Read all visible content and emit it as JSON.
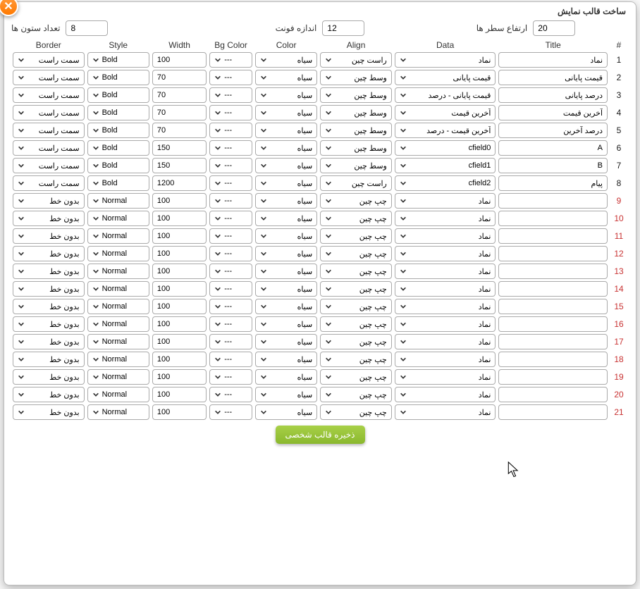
{
  "dialog_title": "ساخت قالب نمایش",
  "close_icon": "✕",
  "top": {
    "columns_label": "تعداد ستون ها",
    "columns_value": "8",
    "font_label": "اندازه فونت",
    "font_value": "12",
    "row_height_label": "ارتفاع سطر ها",
    "row_height_value": "20"
  },
  "headers": {
    "hash": "#",
    "title": "Title",
    "data": "Data",
    "align": "Align",
    "color": "Color",
    "bg": "Bg Color",
    "width": "Width",
    "style": "Style",
    "border": "Border"
  },
  "rows": [
    {
      "n": "1",
      "active": true,
      "title": "نماد",
      "data": "نماد",
      "align": "راست چین",
      "color": "سیاه",
      "bg": "---",
      "width": "100",
      "style": "Bold",
      "border": "سمت راست"
    },
    {
      "n": "2",
      "active": true,
      "title": "قیمت پایانی",
      "data": "قیمت پایانی",
      "align": "وسط چین",
      "color": "سیاه",
      "bg": "---",
      "width": "70",
      "style": "Bold",
      "border": "سمت راست"
    },
    {
      "n": "3",
      "active": true,
      "title": "درصد پایانی",
      "data": "قیمت پایانی - درصد",
      "align": "وسط چین",
      "color": "سیاه",
      "bg": "---",
      "width": "70",
      "style": "Bold",
      "border": "سمت راست"
    },
    {
      "n": "4",
      "active": true,
      "title": "آخرین قیمت",
      "data": "آخرین قیمت",
      "align": "وسط چین",
      "color": "سیاه",
      "bg": "---",
      "width": "70",
      "style": "Bold",
      "border": "سمت راست"
    },
    {
      "n": "5",
      "active": true,
      "title": "درصد آخرین",
      "data": "آخرین قیمت - درصد",
      "align": "وسط چین",
      "color": "سیاه",
      "bg": "---",
      "width": "70",
      "style": "Bold",
      "border": "سمت راست"
    },
    {
      "n": "6",
      "active": true,
      "title": "A",
      "data": "cfield0",
      "align": "وسط چین",
      "color": "سیاه",
      "bg": "---",
      "width": "150",
      "style": "Bold",
      "border": "سمت راست"
    },
    {
      "n": "7",
      "active": true,
      "title": "B",
      "data": "cfield1",
      "align": "وسط چین",
      "color": "سیاه",
      "bg": "---",
      "width": "150",
      "style": "Bold",
      "border": "سمت راست"
    },
    {
      "n": "8",
      "active": true,
      "title": "پیام",
      "data": "cfield2",
      "align": "راست چین",
      "color": "سیاه",
      "bg": "---",
      "width": "1200",
      "style": "Bold",
      "border": "سمت راست"
    },
    {
      "n": "9",
      "active": false,
      "title": "",
      "data": "نماد",
      "align": "چپ چین",
      "color": "سیاه",
      "bg": "---",
      "width": "100",
      "style": "Normal",
      "border": "بدون خط"
    },
    {
      "n": "10",
      "active": false,
      "title": "",
      "data": "نماد",
      "align": "چپ چین",
      "color": "سیاه",
      "bg": "---",
      "width": "100",
      "style": "Normal",
      "border": "بدون خط"
    },
    {
      "n": "11",
      "active": false,
      "title": "",
      "data": "نماد",
      "align": "چپ چین",
      "color": "سیاه",
      "bg": "---",
      "width": "100",
      "style": "Normal",
      "border": "بدون خط"
    },
    {
      "n": "12",
      "active": false,
      "title": "",
      "data": "نماد",
      "align": "چپ چین",
      "color": "سیاه",
      "bg": "---",
      "width": "100",
      "style": "Normal",
      "border": "بدون خط"
    },
    {
      "n": "13",
      "active": false,
      "title": "",
      "data": "نماد",
      "align": "چپ چین",
      "color": "سیاه",
      "bg": "---",
      "width": "100",
      "style": "Normal",
      "border": "بدون خط"
    },
    {
      "n": "14",
      "active": false,
      "title": "",
      "data": "نماد",
      "align": "چپ چین",
      "color": "سیاه",
      "bg": "---",
      "width": "100",
      "style": "Normal",
      "border": "بدون خط"
    },
    {
      "n": "15",
      "active": false,
      "title": "",
      "data": "نماد",
      "align": "چپ چین",
      "color": "سیاه",
      "bg": "---",
      "width": "100",
      "style": "Normal",
      "border": "بدون خط"
    },
    {
      "n": "16",
      "active": false,
      "title": "",
      "data": "نماد",
      "align": "چپ چین",
      "color": "سیاه",
      "bg": "---",
      "width": "100",
      "style": "Normal",
      "border": "بدون خط"
    },
    {
      "n": "17",
      "active": false,
      "title": "",
      "data": "نماد",
      "align": "چپ چین",
      "color": "سیاه",
      "bg": "---",
      "width": "100",
      "style": "Normal",
      "border": "بدون خط"
    },
    {
      "n": "18",
      "active": false,
      "title": "",
      "data": "نماد",
      "align": "چپ چین",
      "color": "سیاه",
      "bg": "---",
      "width": "100",
      "style": "Normal",
      "border": "بدون خط"
    },
    {
      "n": "19",
      "active": false,
      "title": "",
      "data": "نماد",
      "align": "چپ چین",
      "color": "سیاه",
      "bg": "---",
      "width": "100",
      "style": "Normal",
      "border": "بدون خط"
    },
    {
      "n": "20",
      "active": false,
      "title": "",
      "data": "نماد",
      "align": "چپ چین",
      "color": "سیاه",
      "bg": "---",
      "width": "100",
      "style": "Normal",
      "border": "بدون خط"
    },
    {
      "n": "21",
      "active": false,
      "title": "",
      "data": "نماد",
      "align": "چپ چین",
      "color": "سیاه",
      "bg": "---",
      "width": "100",
      "style": "Normal",
      "border": "بدون خط"
    }
  ],
  "save_label": "ذخیره قالب شخصی"
}
